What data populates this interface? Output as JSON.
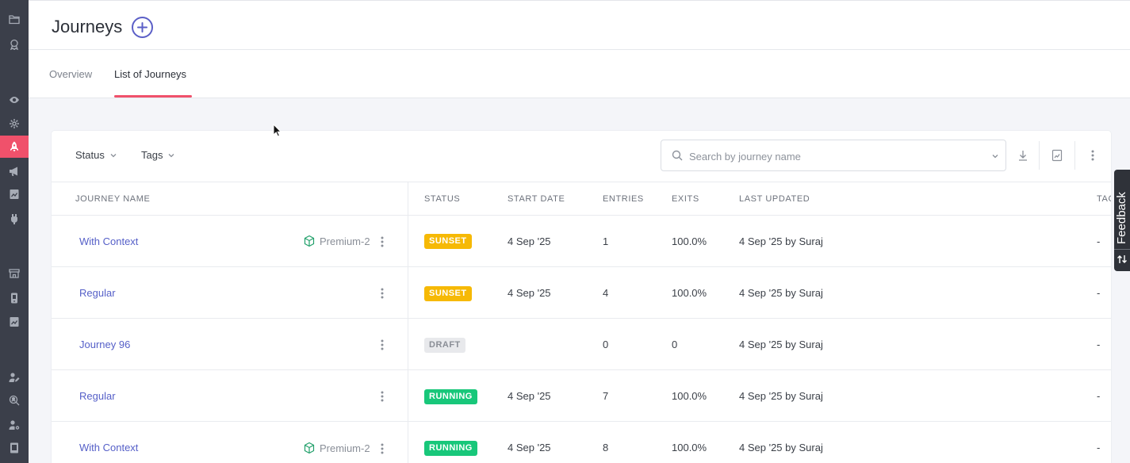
{
  "header": {
    "title": "Journeys"
  },
  "tabs": [
    {
      "label": "Overview",
      "active": false
    },
    {
      "label": "List of Journeys",
      "active": true
    }
  ],
  "filters": {
    "status": "Status",
    "tags": "Tags"
  },
  "search": {
    "placeholder": "Search by journey name"
  },
  "columns": {
    "name": "JOURNEY NAME",
    "status": "STATUS",
    "start_date": "START DATE",
    "entries": "ENTRIES",
    "exits": "EXITS",
    "last_updated": "LAST UPDATED",
    "tags": "TAG"
  },
  "rows": [
    {
      "name": "With Context",
      "context": "Premium-2",
      "status": "SUNSET",
      "status_kind": "sunset",
      "start_date": "4 Sep '25",
      "entries": "1",
      "exits": "100.0%",
      "last_updated": "4 Sep '25 by Suraj",
      "tags": "-"
    },
    {
      "name": "Regular",
      "context": "",
      "status": "SUNSET",
      "status_kind": "sunset",
      "start_date": "4 Sep '25",
      "entries": "4",
      "exits": "100.0%",
      "last_updated": "4 Sep '25 by Suraj",
      "tags": "-"
    },
    {
      "name": "Journey 96",
      "context": "",
      "status": "DRAFT",
      "status_kind": "draft",
      "start_date": "",
      "entries": "0",
      "exits": "0",
      "last_updated": "4 Sep '25 by Suraj",
      "tags": "-"
    },
    {
      "name": "Regular",
      "context": "",
      "status": "RUNNING",
      "status_kind": "running",
      "start_date": "4 Sep '25",
      "entries": "7",
      "exits": "100.0%",
      "last_updated": "4 Sep '25 by Suraj",
      "tags": "-"
    },
    {
      "name": "With Context",
      "context": "Premium-2",
      "status": "RUNNING",
      "status_kind": "running",
      "start_date": "4 Sep '25",
      "entries": "8",
      "exits": "100.0%",
      "last_updated": "4 Sep '25 by Suraj",
      "tags": "-"
    }
  ],
  "feedback": {
    "label": "Feedback"
  },
  "colors": {
    "accent": "#f0516b",
    "link": "#5660c8",
    "sunset": "#f6b905",
    "running": "#18c77a",
    "sidebar": "#3b3f4a"
  },
  "sidebar": {
    "icons": [
      "folder-icon",
      "award-icon",
      "eye-icon",
      "sparkle-icon",
      "rocket-icon",
      "megaphone-icon",
      "report-icon",
      "plugin-icon",
      "store-icon",
      "mobile-icon",
      "chart-icon",
      "user-edit-icon",
      "user-search-icon",
      "user-settings-icon",
      "billing-icon"
    ],
    "active": "rocket-icon"
  }
}
